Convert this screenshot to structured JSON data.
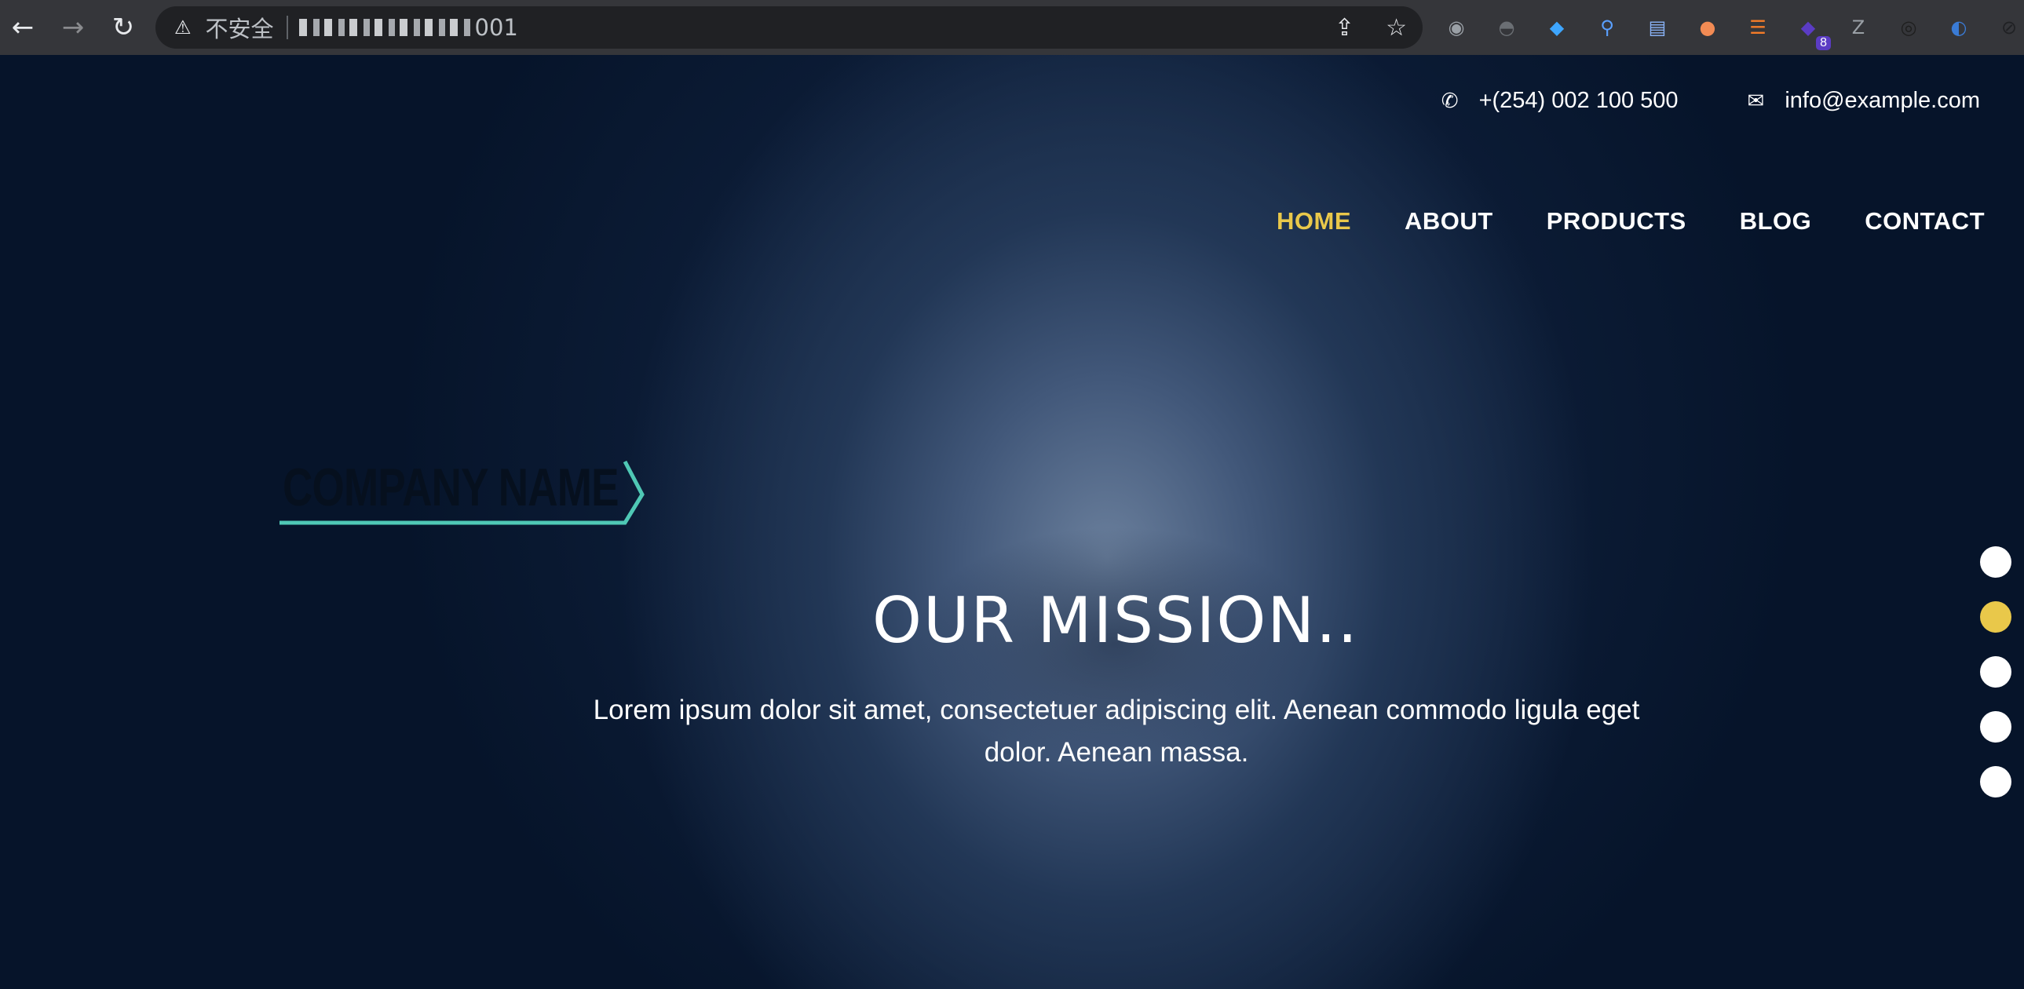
{
  "browser": {
    "back_icon": "←",
    "forward_icon": "→",
    "reload_icon": "↻",
    "warning_icon": "⚠",
    "insecure_label": "不安全",
    "url_suffix": "001",
    "share_icon": "⇪",
    "star_icon": "☆",
    "extensions": [
      {
        "name": "circle-extension-icon",
        "glyph": "◉",
        "color": "#9aa0a6"
      },
      {
        "name": "hat-extension-icon",
        "glyph": "◓",
        "color": "#6b6f74"
      },
      {
        "name": "gem-extension-icon",
        "glyph": "◆",
        "color": "#3ea6ff"
      },
      {
        "name": "pin-extension-icon",
        "glyph": "⚲",
        "color": "#5aa0ff"
      },
      {
        "name": "card-extension-icon",
        "glyph": "▤",
        "color": "#8ab4f8"
      },
      {
        "name": "orange-extension-icon",
        "glyph": "●",
        "color": "#f28b54"
      },
      {
        "name": "rss-extension-icon",
        "glyph": "☰",
        "color": "#f57c28"
      },
      {
        "name": "cube-extension-icon",
        "glyph": "◆",
        "color": "#5b3cc4",
        "badge": "8"
      },
      {
        "name": "z-extension-icon",
        "glyph": "Z",
        "color": "#9aa0a6"
      },
      {
        "name": "eyes-extension-icon",
        "glyph": "◎",
        "color": "#1e1e1e"
      },
      {
        "name": "moon-extension-icon",
        "glyph": "◐",
        "color": "#3a7bd5"
      },
      {
        "name": "slash-extension-icon",
        "glyph": "⊘",
        "color": "#202124"
      }
    ]
  },
  "contact": {
    "phone_icon": "✆",
    "phone": "+(254) 002 100 500",
    "email_icon": "✉",
    "email": "info@example.com"
  },
  "nav": {
    "items": [
      {
        "label": "HOME",
        "active": true
      },
      {
        "label": "ABOUT"
      },
      {
        "label": "PRODUCTS"
      },
      {
        "label": "BLOG"
      },
      {
        "label": "CONTACT"
      }
    ]
  },
  "logo": {
    "text": "COMPANY NAME",
    "accent_color": "#4fc8b5"
  },
  "hero": {
    "title": "OUR MISSION..",
    "text": "Lorem ipsum dolor sit amet, consectetuer adipiscing elit. Aenean commodo ligula eget dolor. Aenean massa."
  },
  "slider": {
    "count": 5,
    "active_index": 1,
    "active_color": "#e9c84a"
  }
}
